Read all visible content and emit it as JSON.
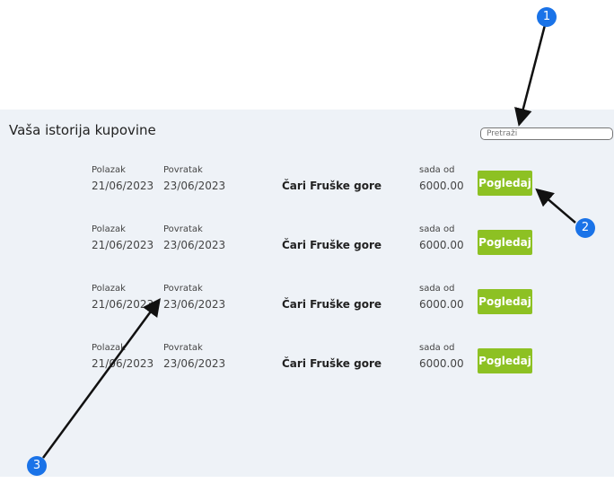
{
  "page": {
    "title": "Vaša istorija kupovine",
    "search_placeholder": "Pretraži"
  },
  "purchases": [
    {
      "depart_label": "Polazak",
      "depart": "21/06/2023",
      "return_label": "Povratak",
      "return": "23/06/2023",
      "name": "Čari Fruške gore",
      "price_label": "sada od",
      "price": "6000.00",
      "button": "Pogledaj"
    },
    {
      "depart_label": "Polazak",
      "depart": "21/06/2023",
      "return_label": "Povratak",
      "return": "23/06/2023",
      "name": "Čari Fruške gore",
      "price_label": "sada od",
      "price": "6000.00",
      "button": "Pogledaj"
    },
    {
      "depart_label": "Polazak",
      "depart": "21/06/2023",
      "return_label": "Povratak",
      "return": "23/06/2023",
      "name": "Čari Fruške gore",
      "price_label": "sada od",
      "price": "6000.00",
      "button": "Pogledaj"
    },
    {
      "depart_label": "Polazak",
      "depart": "21/06/2023",
      "return_label": "Povratak",
      "return": "23/06/2023",
      "name": "Čari Fruške gore",
      "price_label": "sada od",
      "price": "6000.00",
      "button": "Pogledaj"
    }
  ],
  "annotations": {
    "marker_1": "1",
    "marker_2": "2",
    "marker_3": "3",
    "marker_color": "#1a73e8"
  },
  "colors": {
    "button": "#8dc123",
    "panel": "#eef2f7"
  }
}
